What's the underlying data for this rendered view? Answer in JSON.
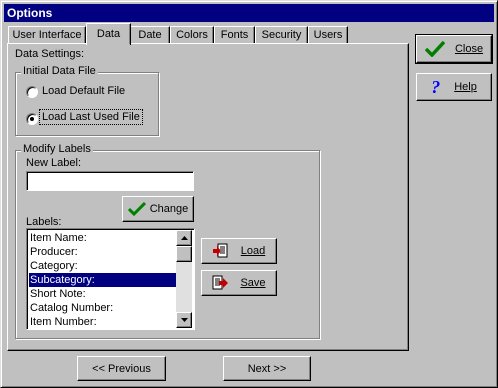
{
  "window": {
    "title": "Options"
  },
  "tabs": [
    {
      "label": "User Interface"
    },
    {
      "label": "Data"
    },
    {
      "label": "Date"
    },
    {
      "label": "Colors"
    },
    {
      "label": "Fonts"
    },
    {
      "label": "Security"
    },
    {
      "label": "Users"
    }
  ],
  "data_settings": {
    "label": "Data Settings:",
    "initial_file": {
      "label": "Initial Data File",
      "options": [
        {
          "label": "Load Default File",
          "selected": false
        },
        {
          "label": "Load Last Used File",
          "selected": true
        }
      ]
    },
    "modify_labels": {
      "label": "Modify Labels",
      "new_label_caption": "New Label:",
      "new_label_value": "",
      "change_button": "Change",
      "labels_caption": "Labels:",
      "labels": [
        "Item Name:",
        "Producer:",
        "Category:",
        "Subcategory:",
        "Short Note:",
        "Catalog Number:",
        "Item Number:"
      ],
      "selected_label": "Subcategory:",
      "load_button": "Load",
      "save_button": "Save"
    }
  },
  "side_buttons": {
    "close": "Close",
    "help": "Help"
  },
  "nav": {
    "previous": "<< Previous",
    "next": "Next >>"
  },
  "colors": {
    "title_bar": "#000080",
    "face": "#c0c0c0",
    "selection": "#000080",
    "check_green": "#008000",
    "help_blue": "#0000ff"
  }
}
